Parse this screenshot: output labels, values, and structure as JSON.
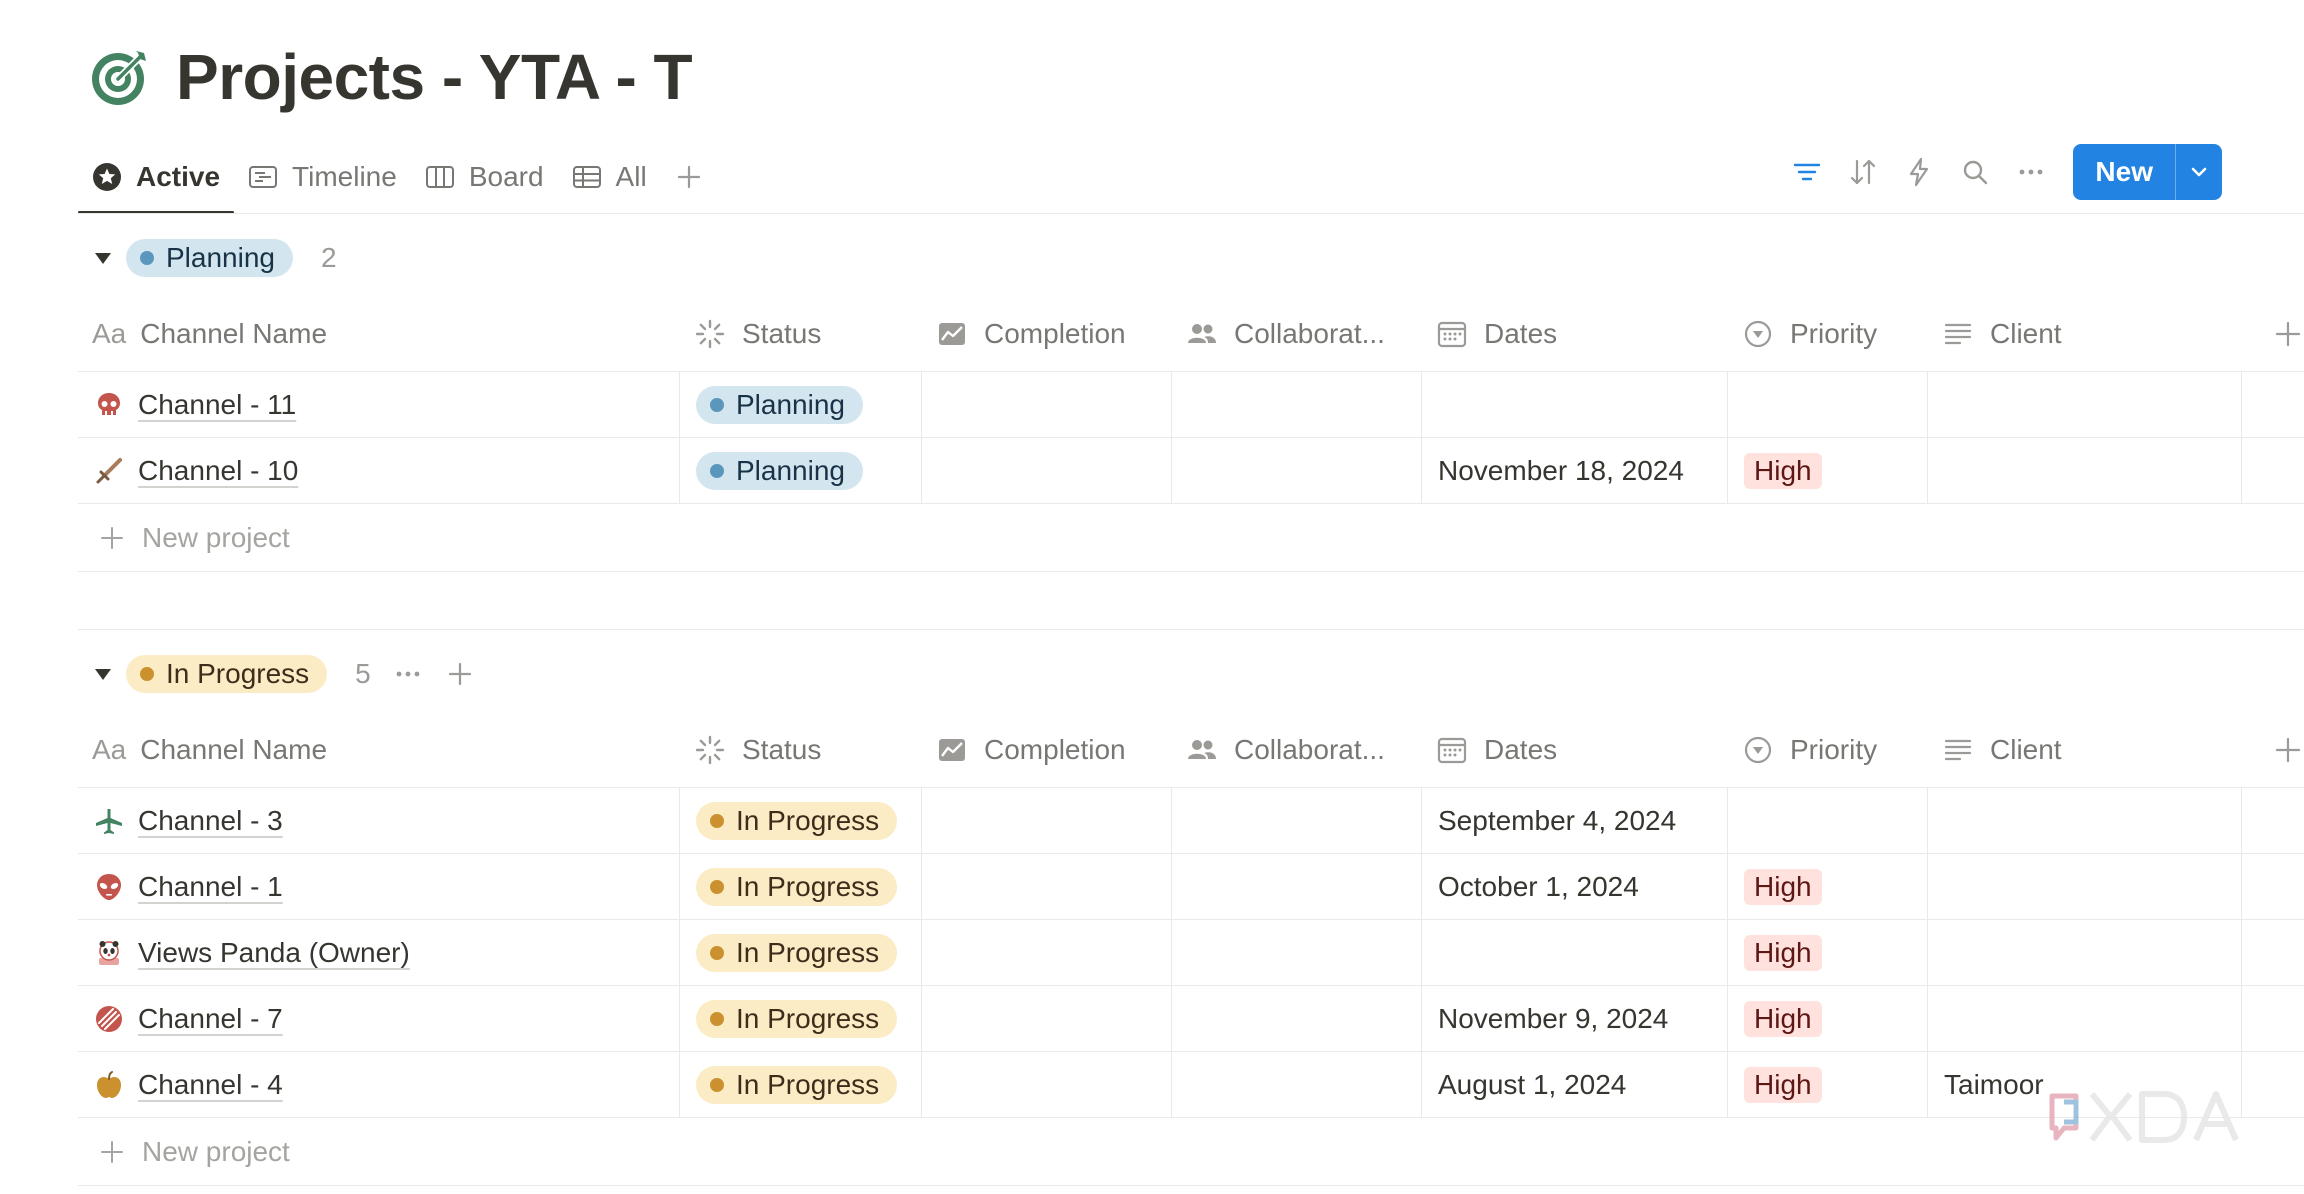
{
  "page": {
    "title": "Projects - YTA - T",
    "icon": "target-icon"
  },
  "tabs": [
    {
      "label": "Active",
      "icon": "star-circle-icon",
      "active": true
    },
    {
      "label": "Timeline",
      "icon": "timeline-icon"
    },
    {
      "label": "Board",
      "icon": "board-icon"
    },
    {
      "label": "All",
      "icon": "table-icon"
    }
  ],
  "toolbar": {
    "new_label": "New",
    "accent": "#2383e2"
  },
  "columns": {
    "name": "Channel Name",
    "name_prefix": "Aa",
    "status": "Status",
    "completion": "Completion",
    "collaborators": "Collaborat...",
    "dates": "Dates",
    "priority": "Priority",
    "client": "Client"
  },
  "groups": [
    {
      "label": "Planning",
      "count": "2",
      "color": "#5b97bd",
      "rows": [
        {
          "name": "Channel - 11",
          "icon": "skull-icon",
          "status": "Planning",
          "date": "",
          "priority": "",
          "client": ""
        },
        {
          "name": "Channel - 10",
          "icon": "sword-icon",
          "status": "Planning",
          "date": "November 18, 2024",
          "priority": "High",
          "client": ""
        }
      ],
      "new_label": "New project"
    },
    {
      "label": "In Progress",
      "count": "5",
      "color": "#cb912f",
      "rows": [
        {
          "name": "Channel - 3",
          "icon": "airplane-icon",
          "status": "In Progress",
          "date": "September 4, 2024",
          "priority": "",
          "client": ""
        },
        {
          "name": "Channel - 1",
          "icon": "alien-icon",
          "status": "In Progress",
          "date": "October 1, 2024",
          "priority": "High",
          "client": ""
        },
        {
          "name": "Views Panda (Owner)",
          "icon": "panda-icon",
          "status": "In Progress",
          "date": "",
          "priority": "High",
          "client": ""
        },
        {
          "name": "Channel - 7",
          "icon": "ball-icon",
          "status": "In Progress",
          "date": "November 9, 2024",
          "priority": "High",
          "client": ""
        },
        {
          "name": "Channel - 4",
          "icon": "apple-icon",
          "status": "In Progress",
          "date": "August 1, 2024",
          "priority": "High",
          "client": "Taimoor"
        }
      ],
      "new_label": "New project"
    }
  ]
}
